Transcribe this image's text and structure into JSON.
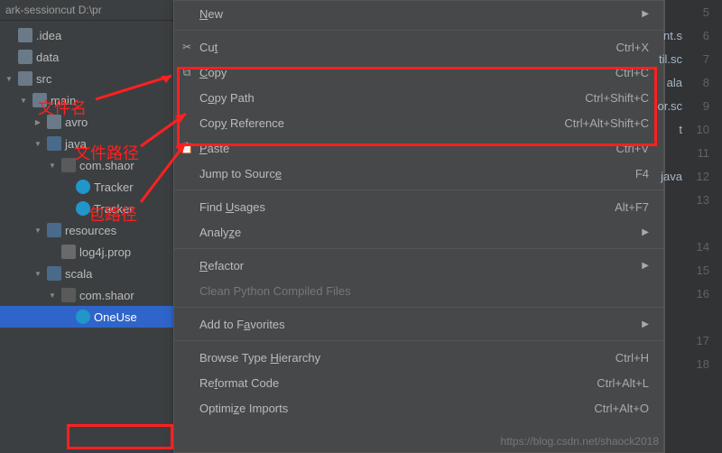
{
  "crumbs": "ark-sessioncut  D:\\pr",
  "tree": [
    {
      "depth": 0,
      "arrow": "none",
      "icon": "folder",
      "label": ".idea"
    },
    {
      "depth": 0,
      "arrow": "none",
      "icon": "folder",
      "label": "data"
    },
    {
      "depth": 0,
      "arrow": "open",
      "icon": "folder",
      "label": "src"
    },
    {
      "depth": 1,
      "arrow": "open",
      "icon": "folder",
      "label": "main"
    },
    {
      "depth": 2,
      "arrow": "closed",
      "icon": "folder",
      "label": "avro"
    },
    {
      "depth": 2,
      "arrow": "open",
      "icon": "folder-s",
      "label": "java"
    },
    {
      "depth": 3,
      "arrow": "open",
      "icon": "pkg",
      "label": "com.shaor"
    },
    {
      "depth": 4,
      "arrow": "none",
      "icon": "class",
      "label": "Tracker"
    },
    {
      "depth": 4,
      "arrow": "none",
      "icon": "class",
      "label": "Tracker"
    },
    {
      "depth": 2,
      "arrow": "open",
      "icon": "folder-s",
      "label": "resources"
    },
    {
      "depth": 3,
      "arrow": "none",
      "icon": "file",
      "label": "log4j.prop"
    },
    {
      "depth": 2,
      "arrow": "open",
      "icon": "folder-s",
      "label": "scala"
    },
    {
      "depth": 3,
      "arrow": "open",
      "icon": "pkg",
      "label": "com.shaor"
    },
    {
      "depth": 4,
      "arrow": "none",
      "icon": "class",
      "label": "OneUse",
      "sel": true
    }
  ],
  "menu": [
    {
      "label_html": "<u>N</u>ew",
      "submenu": true
    },
    {
      "sep": true
    },
    {
      "icon": "✂",
      "label_html": "Cu<u>t</u>",
      "shortcut": "Ctrl+X"
    },
    {
      "icon": "⧉",
      "label_html": "<u>C</u>opy",
      "shortcut": "Ctrl+C"
    },
    {
      "label_html": "C<u>o</u>py Path",
      "shortcut": "Ctrl+Shift+C"
    },
    {
      "label_html": "Cop<u>y</u> Reference",
      "shortcut": "Ctrl+Alt+Shift+C"
    },
    {
      "icon": "📋",
      "label_html": "<u>P</u>aste",
      "shortcut": "Ctrl+V"
    },
    {
      "label_html": "Jump to Sourc<u>e</u>",
      "shortcut": "F4"
    },
    {
      "sep": true
    },
    {
      "label_html": "Find <u>U</u>sages",
      "shortcut": "Alt+F7"
    },
    {
      "label_html": "Analy<u>z</u>e",
      "submenu": true
    },
    {
      "sep": true
    },
    {
      "label_html": "<u>R</u>efactor",
      "submenu": true
    },
    {
      "label_html": "Clean Python Compiled Files",
      "disabled": true
    },
    {
      "sep": true
    },
    {
      "label_html": "Add to F<u>a</u>vorites",
      "submenu": true
    },
    {
      "sep": true
    },
    {
      "label_html": "Browse Type <u>H</u>ierarchy",
      "shortcut": "Ctrl+H"
    },
    {
      "label_html": "Re<u>f</u>ormat Code",
      "shortcut": "Ctrl+Alt+L"
    },
    {
      "label_html": "Optimi<u>z</u>e Imports",
      "shortcut": "Ctrl+Alt+O"
    }
  ],
  "editor_tabs": [
    "",
    "nt.s",
    "til.sc",
    "ala",
    "or.sc",
    "t",
    "",
    "java",
    ""
  ],
  "line_numbers": [
    "5",
    "6",
    "7",
    "8",
    "9",
    "10",
    "11",
    "12",
    "13",
    "",
    "14",
    "15",
    "16",
    "",
    "17",
    "18"
  ],
  "annotations": {
    "copy_block": "Copy / Copy Path / Copy Reference highlighted",
    "labels": {
      "filename": "文件名",
      "filepath": "文件路径",
      "pkgpath": "包路径"
    }
  },
  "watermark": "https://blog.csdn.net/shaock2018"
}
